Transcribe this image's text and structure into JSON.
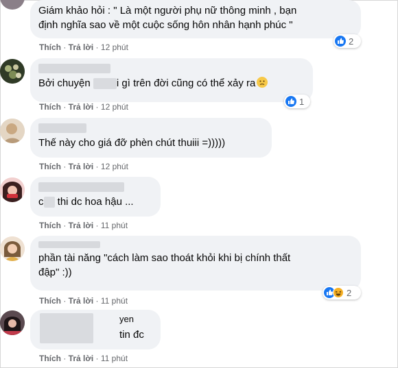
{
  "comments": [
    {
      "text": "Giám khảo hỏi : \" Là một người phụ nữ thông minh , bạn\nđịnh nghĩa sao về một cuộc sống hôn nhân hạnh phúc \"",
      "like": "Thích",
      "reply": "Trả lời",
      "time": "12 phút",
      "reaction_count": "2"
    },
    {
      "text_before": "Bởi chuyện ",
      "text_after": "i gì trên đời cũng có thể xảy ra",
      "like": "Thích",
      "reply": "Trả lời",
      "time": "12 phút",
      "reaction_count": "1"
    },
    {
      "text": "Thế này cho giá đỡ phèn chút thuiii =)))))",
      "like": "Thích",
      "reply": "Trả lời",
      "time": "12 phút"
    },
    {
      "text_before": "c",
      "text_after": " thi dc hoa hậu ...",
      "like": "Thích",
      "reply": "Trả lời",
      "time": "11 phút"
    },
    {
      "text": "phần tài năng \"cách làm sao thoát khỏi khi bị chính thất\nđập\" :))",
      "like": "Thích",
      "reply": "Trả lời",
      "time": "11 phút",
      "reaction_count": "2"
    },
    {
      "line1": "yen",
      "line2": "tin đc",
      "like": "Thích",
      "reply": "Trả lời",
      "time": "11 phút"
    }
  ],
  "colors": {
    "like_blue": "#1877f2",
    "haha_yellow": "#f7b125",
    "bubble": "#f0f2f5",
    "meta": "#65676b"
  }
}
